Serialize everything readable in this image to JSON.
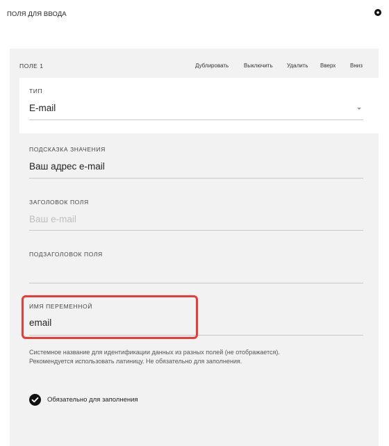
{
  "header": {
    "title": "ПОЛЯ ДЛЯ ВВОДА",
    "icon": "gear-icon"
  },
  "field": {
    "heading": "ПОЛЕ 1",
    "actions": [
      "Дублировать",
      "Выключить",
      "Удалить",
      "Вверх",
      "Вниз"
    ]
  },
  "type_field": {
    "label": "ТИП",
    "value": "E-mail"
  },
  "hint_field": {
    "label": "ПОДСКАЗКА ЗНАЧЕНИЯ",
    "value": "Ваш адрес e-mail"
  },
  "title_field": {
    "label": "ЗАГОЛОВОК ПОЛЯ",
    "placeholder": "Ваш e-mail"
  },
  "subtitle_field": {
    "label": "ПОДЗАГОЛОВОК ПОЛЯ",
    "value": ""
  },
  "variable_field": {
    "label": "ИМЯ ПЕРЕМЕННОЙ",
    "value": "email"
  },
  "help_text": {
    "line1": "Системное название для идентификации данных из разных полей (не отображается).",
    "line2": "Рекомендуется использовать латиницу. Не обязательно для заполнения."
  },
  "required": {
    "label": "Обязательно для заполнения",
    "checked": true
  },
  "colors": {
    "highlight": "#ee3a34",
    "panel": "#f2f2f2"
  }
}
